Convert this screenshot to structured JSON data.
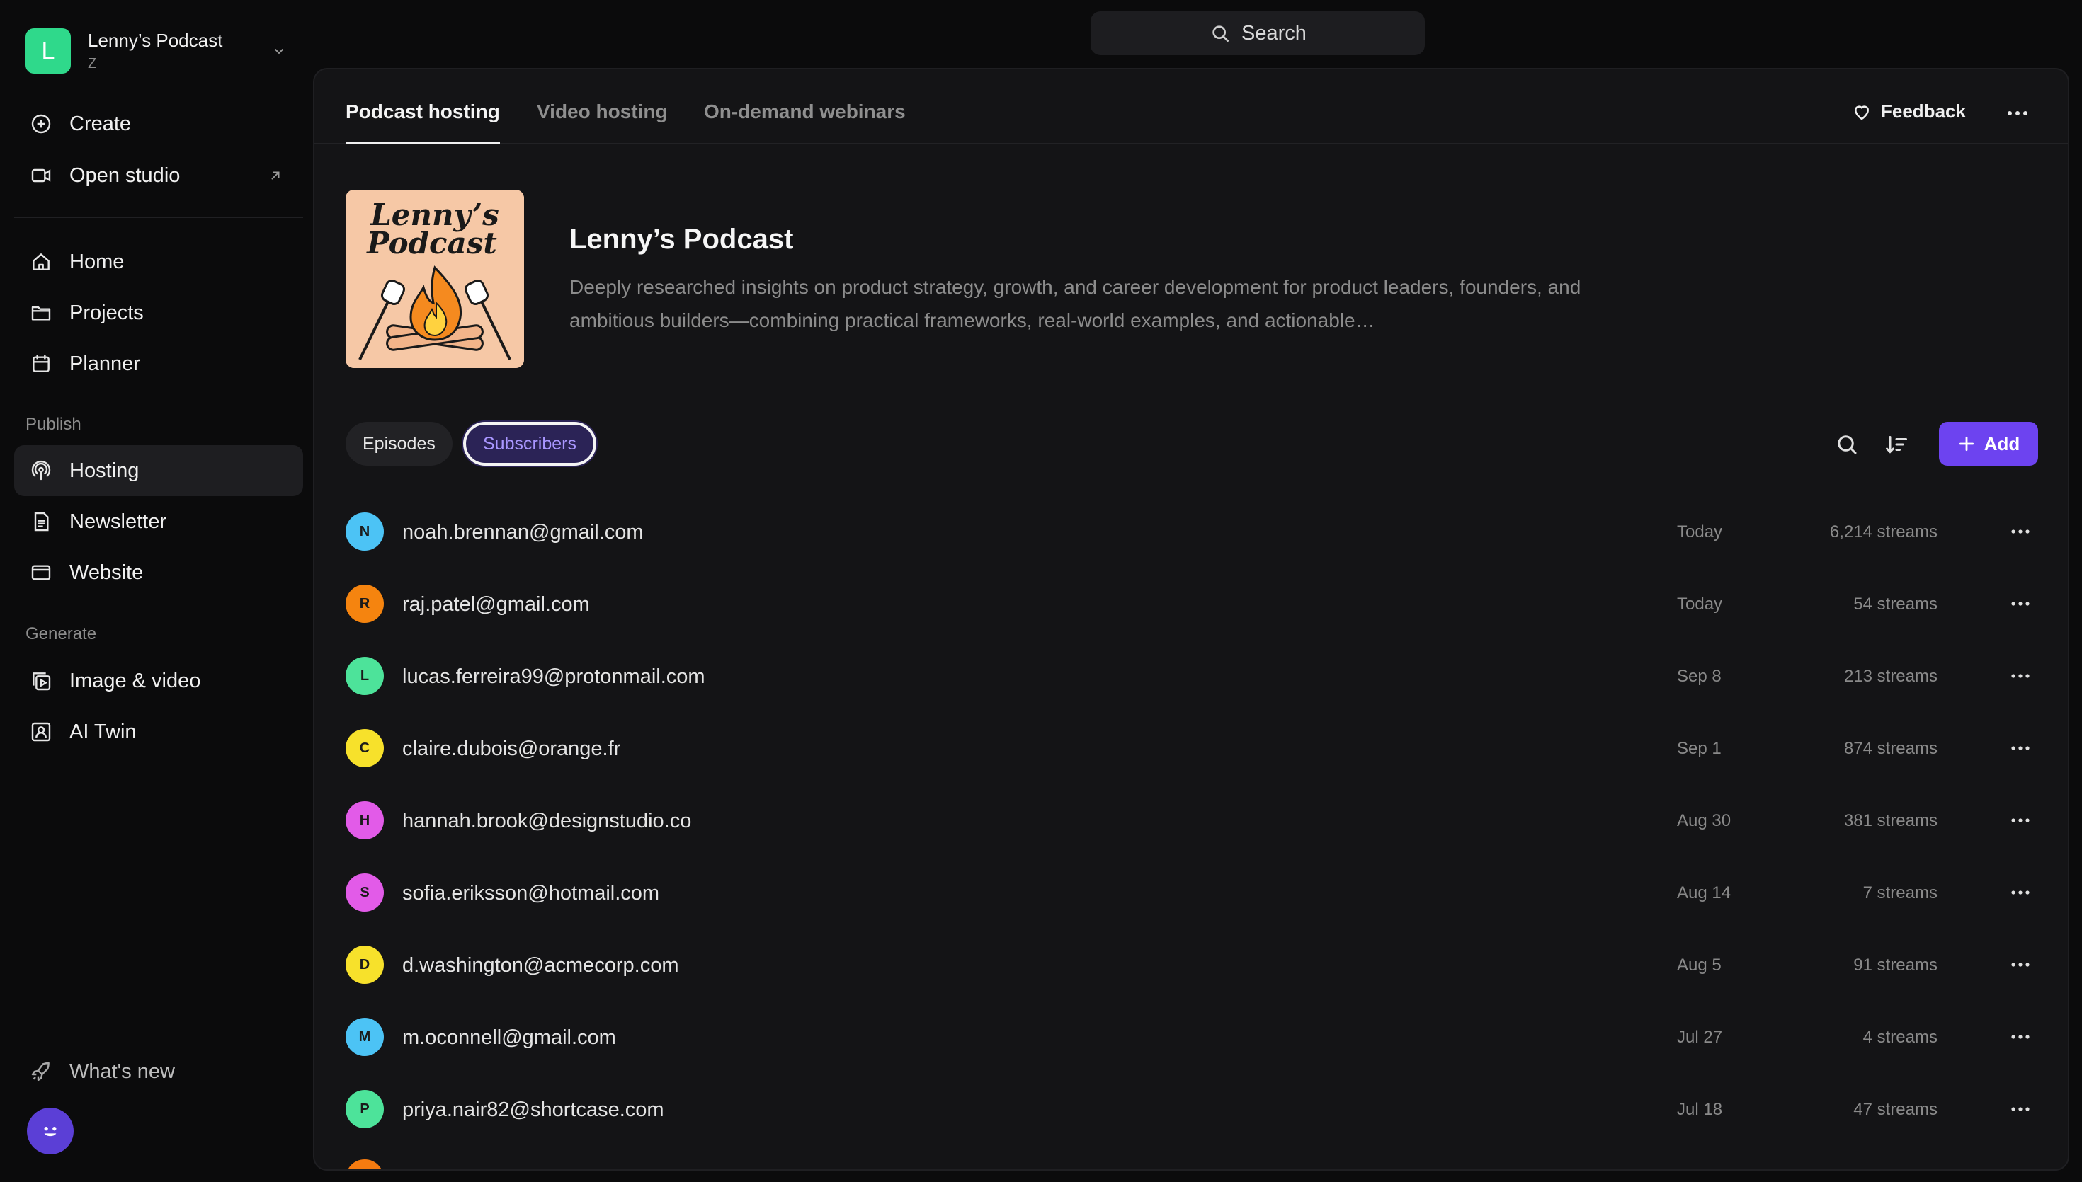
{
  "workspace": {
    "initial": "L",
    "name": "Lenny’s Podcast",
    "sub": "Z"
  },
  "sidebar": {
    "top_items": [
      {
        "label": "Create",
        "icon": "plus-circle-icon"
      },
      {
        "label": "Open studio",
        "icon": "video-camera-icon"
      }
    ],
    "main_items": [
      {
        "label": "Home",
        "icon": "home-icon"
      },
      {
        "label": "Projects",
        "icon": "folder-icon"
      },
      {
        "label": "Planner",
        "icon": "calendar-icon"
      }
    ],
    "publish_label": "Publish",
    "publish_items": [
      {
        "label": "Hosting",
        "icon": "podcast-icon",
        "active": true
      },
      {
        "label": "Newsletter",
        "icon": "document-icon"
      },
      {
        "label": "Website",
        "icon": "browser-icon"
      }
    ],
    "generate_label": "Generate",
    "generate_items": [
      {
        "label": "Image & video",
        "icon": "media-icon"
      },
      {
        "label": "AI Twin",
        "icon": "portrait-icon"
      }
    ],
    "whats_new": "What's new"
  },
  "search": {
    "label": "Search"
  },
  "tabs": [
    "Podcast hosting",
    "Video hosting",
    "On-demand webinars"
  ],
  "feedback_label": "Feedback",
  "podcast": {
    "title": "Lenny’s Podcast",
    "description": "Deeply researched insights on product strategy, growth, and career development for product leaders, founders, and ambitious builders—combining practical frameworks, real-world examples, and actionable…",
    "cover_text_line1": "Lenny’s",
    "cover_text_line2": "Podcast"
  },
  "subtabs": {
    "episodes": "Episodes",
    "subscribers": "Subscribers"
  },
  "add_label": "Add",
  "subscribers": [
    {
      "initial": "N",
      "email": "noah.brennan@gmail.com",
      "date": "Today",
      "streams": "6,214 streams",
      "color": "#4cc3f5"
    },
    {
      "initial": "R",
      "email": "raj.patel@gmail.com",
      "date": "Today",
      "streams": "54 streams",
      "color": "#f5840f"
    },
    {
      "initial": "L",
      "email": "lucas.ferreira99@protonmail.com",
      "date": "Sep 8",
      "streams": "213 streams",
      "color": "#4de39a"
    },
    {
      "initial": "C",
      "email": "claire.dubois@orange.fr",
      "date": "Sep 1",
      "streams": "874 streams",
      "color": "#f7e12b"
    },
    {
      "initial": "H",
      "email": "hannah.brook@designstudio.co",
      "date": "Aug 30",
      "streams": "381 streams",
      "color": "#e25be8"
    },
    {
      "initial": "S",
      "email": "sofia.eriksson@hotmail.com",
      "date": "Aug 14",
      "streams": "7 streams",
      "color": "#e25be8"
    },
    {
      "initial": "D",
      "email": "d.washington@acmecorp.com",
      "date": "Aug 5",
      "streams": "91 streams",
      "color": "#f7e12b"
    },
    {
      "initial": "M",
      "email": "m.oconnell@gmail.com",
      "date": "Jul 27",
      "streams": "4 streams",
      "color": "#4cc3f5"
    },
    {
      "initial": "P",
      "email": "priya.nair82@shortcase.com",
      "date": "Jul 18",
      "streams": "47 streams",
      "color": "#4de39a"
    }
  ],
  "colors": {
    "accent": "#6d43f0",
    "subscribers_pill_text": "#a996ff",
    "workspace_avatar": "#2fd98b",
    "user_avatar": "#5b3fd6"
  }
}
